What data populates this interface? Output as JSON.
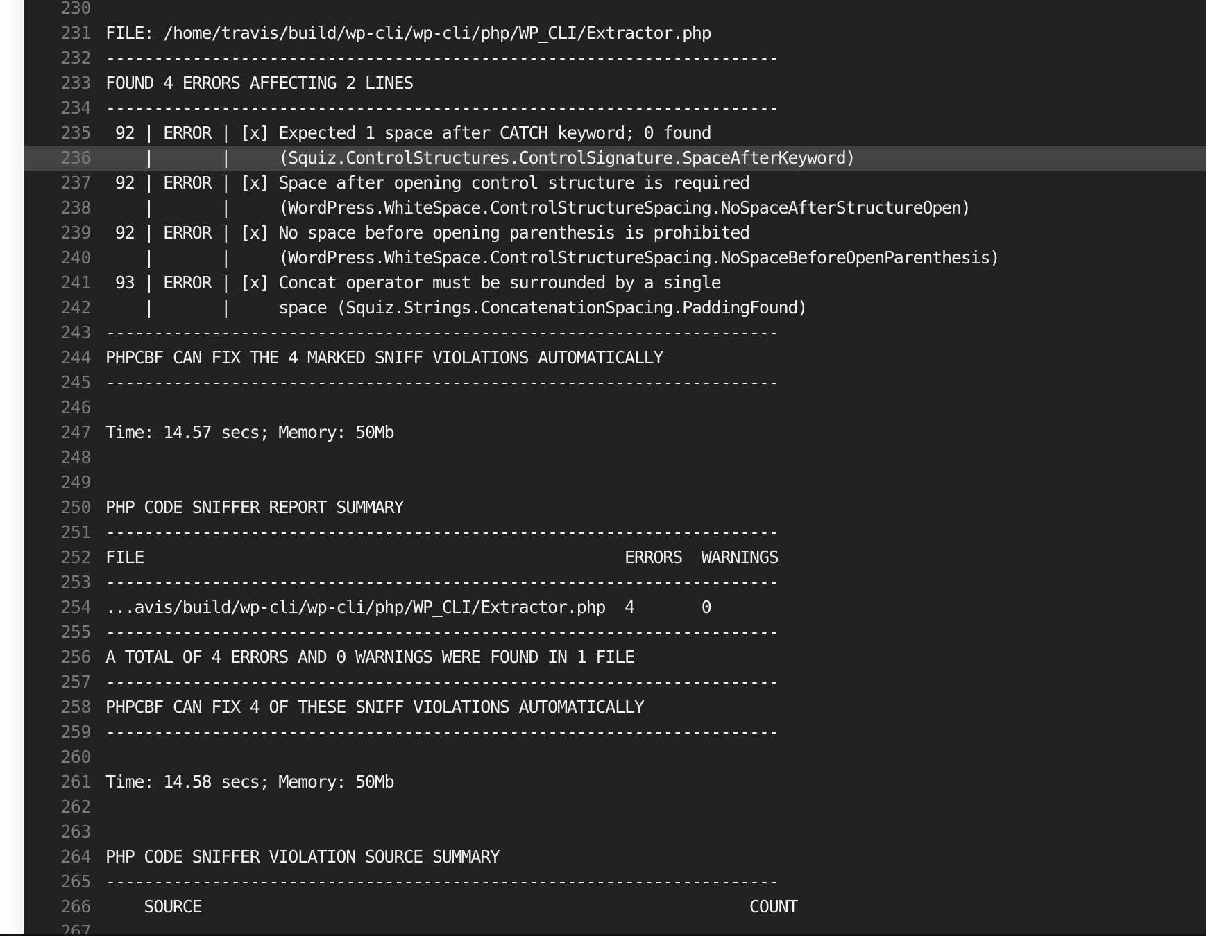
{
  "terminal": {
    "lines": [
      {
        "number": "230",
        "text": ""
      },
      {
        "number": "231",
        "text": "FILE: /home/travis/build/wp-cli/wp-cli/php/WP_CLI/Extractor.php"
      },
      {
        "number": "232",
        "text": "----------------------------------------------------------------------"
      },
      {
        "number": "233",
        "text": "FOUND 4 ERRORS AFFECTING 2 LINES"
      },
      {
        "number": "234",
        "text": "----------------------------------------------------------------------"
      },
      {
        "number": "235",
        "text": " 92 | ERROR | [x] Expected 1 space after CATCH keyword; 0 found"
      },
      {
        "number": "236",
        "text": "    |       |     (Squiz.ControlStructures.ControlSignature.SpaceAfterKeyword)",
        "highlighted": true
      },
      {
        "number": "237",
        "text": " 92 | ERROR | [x] Space after opening control structure is required"
      },
      {
        "number": "238",
        "text": "    |       |     (WordPress.WhiteSpace.ControlStructureSpacing.NoSpaceAfterStructureOpen)"
      },
      {
        "number": "239",
        "text": " 92 | ERROR | [x] No space before opening parenthesis is prohibited"
      },
      {
        "number": "240",
        "text": "    |       |     (WordPress.WhiteSpace.ControlStructureSpacing.NoSpaceBeforeOpenParenthesis)"
      },
      {
        "number": "241",
        "text": " 93 | ERROR | [x] Concat operator must be surrounded by a single"
      },
      {
        "number": "242",
        "text": "    |       |     space (Squiz.Strings.ConcatenationSpacing.PaddingFound)"
      },
      {
        "number": "243",
        "text": "----------------------------------------------------------------------"
      },
      {
        "number": "244",
        "text": "PHPCBF CAN FIX THE 4 MARKED SNIFF VIOLATIONS AUTOMATICALLY"
      },
      {
        "number": "245",
        "text": "----------------------------------------------------------------------"
      },
      {
        "number": "246",
        "text": ""
      },
      {
        "number": "247",
        "text": "Time: 14.57 secs; Memory: 50Mb"
      },
      {
        "number": "248",
        "text": ""
      },
      {
        "number": "249",
        "text": ""
      },
      {
        "number": "250",
        "text": "PHP CODE SNIFFER REPORT SUMMARY"
      },
      {
        "number": "251",
        "text": "----------------------------------------------------------------------"
      },
      {
        "number": "252",
        "text": "FILE                                                  ERRORS  WARNINGS"
      },
      {
        "number": "253",
        "text": "----------------------------------------------------------------------"
      },
      {
        "number": "254",
        "text": "...avis/build/wp-cli/wp-cli/php/WP_CLI/Extractor.php  4       0"
      },
      {
        "number": "255",
        "text": "----------------------------------------------------------------------"
      },
      {
        "number": "256",
        "text": "A TOTAL OF 4 ERRORS AND 0 WARNINGS WERE FOUND IN 1 FILE"
      },
      {
        "number": "257",
        "text": "----------------------------------------------------------------------"
      },
      {
        "number": "258",
        "text": "PHPCBF CAN FIX 4 OF THESE SNIFF VIOLATIONS AUTOMATICALLY"
      },
      {
        "number": "259",
        "text": "----------------------------------------------------------------------"
      },
      {
        "number": "260",
        "text": ""
      },
      {
        "number": "261",
        "text": "Time: 14.58 secs; Memory: 50Mb"
      },
      {
        "number": "262",
        "text": ""
      },
      {
        "number": "263",
        "text": ""
      },
      {
        "number": "264",
        "text": "PHP CODE SNIFFER VIOLATION SOURCE SUMMARY"
      },
      {
        "number": "265",
        "text": "----------------------------------------------------------------------"
      },
      {
        "number": "266",
        "text": "    SOURCE                                                         COUNT"
      },
      {
        "number": "267",
        "text": ""
      }
    ]
  },
  "colors": {
    "background": "#222222",
    "text": "#f1f1f1",
    "line_number": "#7a7a7a",
    "highlight": "#444444"
  }
}
